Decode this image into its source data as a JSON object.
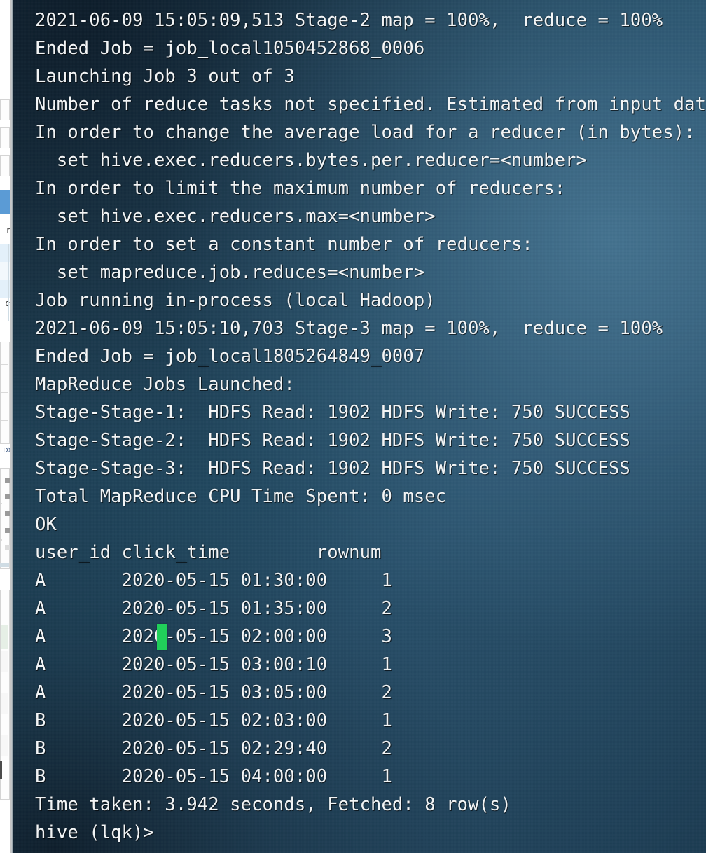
{
  "window": {
    "app_name": "hive-terminal",
    "prompt": "hive (lqk)>"
  },
  "colors": {
    "terminal_bg_dark": "#18303f",
    "terminal_bg_light": "#2c5672",
    "text": "#f2f4f5",
    "cursor": "#21cf5a",
    "bg_app_selection": "#5b9bd5"
  },
  "terminal": {
    "cursor": {
      "visible": true,
      "color": "#21cf5a",
      "over_line_index": 21,
      "over_char": "-"
    },
    "lines": [
      "2021-06-09 15:05:09,513 Stage-2 map = 100%,  reduce = 100%",
      "Ended Job = job_local1050452868_0006",
      "Launching Job 3 out of 3",
      "Number of reduce tasks not specified. Estimated from input data size:",
      "In order to change the average load for a reducer (in bytes):",
      "  set hive.exec.reducers.bytes.per.reducer=<number>",
      "In order to limit the maximum number of reducers:",
      "  set hive.exec.reducers.max=<number>",
      "In order to set a constant number of reducers:",
      "  set mapreduce.job.reduces=<number>",
      "Job running in-process (local Hadoop)",
      "2021-06-09 15:05:10,703 Stage-3 map = 100%,  reduce = 100%",
      "Ended Job = job_local1805264849_0007",
      "MapReduce Jobs Launched:",
      "Stage-Stage-1:  HDFS Read: 1902 HDFS Write: 750 SUCCESS",
      "Stage-Stage-2:  HDFS Read: 1902 HDFS Write: 750 SUCCESS",
      "Stage-Stage-3:  HDFS Read: 1902 HDFS Write: 750 SUCCESS",
      "Total MapReduce CPU Time Spent: 0 msec",
      "OK",
      "user_id click_time        rownum",
      "A       2020-05-15 01:30:00     1",
      "A       2020-05-15 01:35:00     2",
      "A       2020-05-15 02:00:00     3",
      "A       2020-05-15 03:00:10     1",
      "A       2020-05-15 03:05:00     2",
      "B       2020-05-15 02:03:00     1",
      "B       2020-05-15 02:29:40     2",
      "B       2020-05-15 04:00:00     1",
      "Time taken: 3.942 seconds, Fetched: 8 row(s)",
      "hive (lqk)>"
    ]
  },
  "query_result": {
    "type": "table",
    "columns": [
      "user_id",
      "click_time",
      "rownum"
    ],
    "rows": [
      [
        "A",
        "2020-05-15 01:30:00",
        "1"
      ],
      [
        "A",
        "2020-05-15 01:35:00",
        "2"
      ],
      [
        "A",
        "2020-05-15 02:00:00",
        "3"
      ],
      [
        "A",
        "2020-05-15 03:00:10",
        "1"
      ],
      [
        "A",
        "2020-05-15 03:05:00",
        "2"
      ],
      [
        "B",
        "2020-05-15 02:03:00",
        "1"
      ],
      [
        "B",
        "2020-05-15 02:29:40",
        "2"
      ],
      [
        "B",
        "2020-05-15 04:00:00",
        "1"
      ]
    ],
    "row_count": 8,
    "time_taken_seconds": "3.942",
    "status": "OK"
  },
  "job_summary": {
    "jobs_launched_label": "MapReduce Jobs Launched:",
    "stages": [
      {
        "name": "Stage-Stage-1",
        "hdfs_read": "1902",
        "hdfs_write": "750",
        "status": "SUCCESS"
      },
      {
        "name": "Stage-Stage-2",
        "hdfs_read": "1902",
        "hdfs_write": "750",
        "status": "SUCCESS"
      },
      {
        "name": "Stage-Stage-3",
        "hdfs_read": "1902",
        "hdfs_write": "750",
        "status": "SUCCESS"
      }
    ],
    "total_cpu_time": "0 msec",
    "jobs": [
      {
        "id": "job_local1050452868_0006",
        "stage": "Stage-2",
        "map": "100%",
        "reduce": "100%",
        "timestamp": "2021-06-09 15:05:09,513"
      },
      {
        "id": "job_local1805264849_0007",
        "stage": "Stage-3",
        "map": "100%",
        "reduce": "100%",
        "timestamp": "2021-06-09 15:05:10,703"
      }
    ]
  },
  "background_app": {
    "visible_sliver": true,
    "glyph_fragments": [
      "r",
      "c"
    ]
  }
}
